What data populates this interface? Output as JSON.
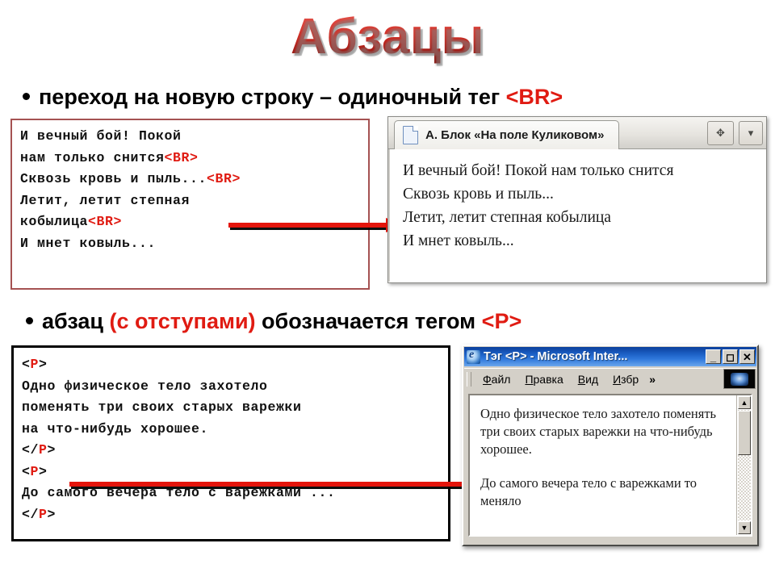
{
  "slide": {
    "title": "Абзацы"
  },
  "bullets": [
    {
      "text_before": "переход на новую строку – одиночный тег ",
      "tag": "<BR>"
    },
    {
      "text_a": "абзац ",
      "highlight": "(с отступами)",
      "text_b": " обозначается  тегом ",
      "tag": "<P>"
    }
  ],
  "code_box_1": {
    "lines": [
      {
        "text": "И вечный бой! Покой"
      },
      {
        "text": "нам только снится",
        "tag": "<BR>"
      },
      {
        "text": "Сквозь кровь и пыль...",
        "tag": "<BR>"
      },
      {
        "text": "Летит, летит степная"
      },
      {
        "text": "кобылица",
        "tag": "<BR>"
      },
      {
        "text": "И мнет ковыль..."
      }
    ]
  },
  "code_box_2": {
    "line_1_open": "<",
    "line_1_tag": "P",
    "line_1_close": ">",
    "lines": [
      "Одно физическое тело захотело",
      "поменять три своих старых варежки",
      "на что-нибудь хорошее."
    ],
    "close_open": "</",
    "close_tag": "P",
    "close_close": ">",
    "line_last": "До самого вечера тело с варежками ..."
  },
  "browser_1": {
    "tab_title": "А. Блок «На поле Куликовом»",
    "tab_icon": "document-icon",
    "btn_move_glyph": "✥",
    "btn_menu_glyph": "▾",
    "content_lines": [
      "И вечный бой! Покой нам только снится",
      "Сквозь кровь и пыль...",
      "Летит, летит степная кобылица",
      "И мнет ковыль..."
    ]
  },
  "browser_2": {
    "title": "Тэг <P> - Microsoft Inter...",
    "window_buttons": {
      "minimize": "_",
      "maximize": "◻",
      "close": "✕"
    },
    "menu": [
      {
        "accel": "Ф",
        "rest": "айл"
      },
      {
        "accel": "П",
        "rest": "равка"
      },
      {
        "accel": "В",
        "rest": "ид"
      },
      {
        "accel": "И",
        "rest": "збр"
      }
    ],
    "menu_overflow": "»",
    "paragraphs": [
      "Одно физическое тело захотело поменять три своих старых варежки на что-нибудь хорошее.",
      "До самого вечера тело с варежками то меняло"
    ],
    "scroll_up_glyph": "▲",
    "scroll_down_glyph": "▼"
  },
  "colors": {
    "accent_red": "#e01b12",
    "arrow_red": "#e4150c",
    "code_box_1_border": "#a55252",
    "ie_titlebar_blue": "#1c5fc4"
  }
}
